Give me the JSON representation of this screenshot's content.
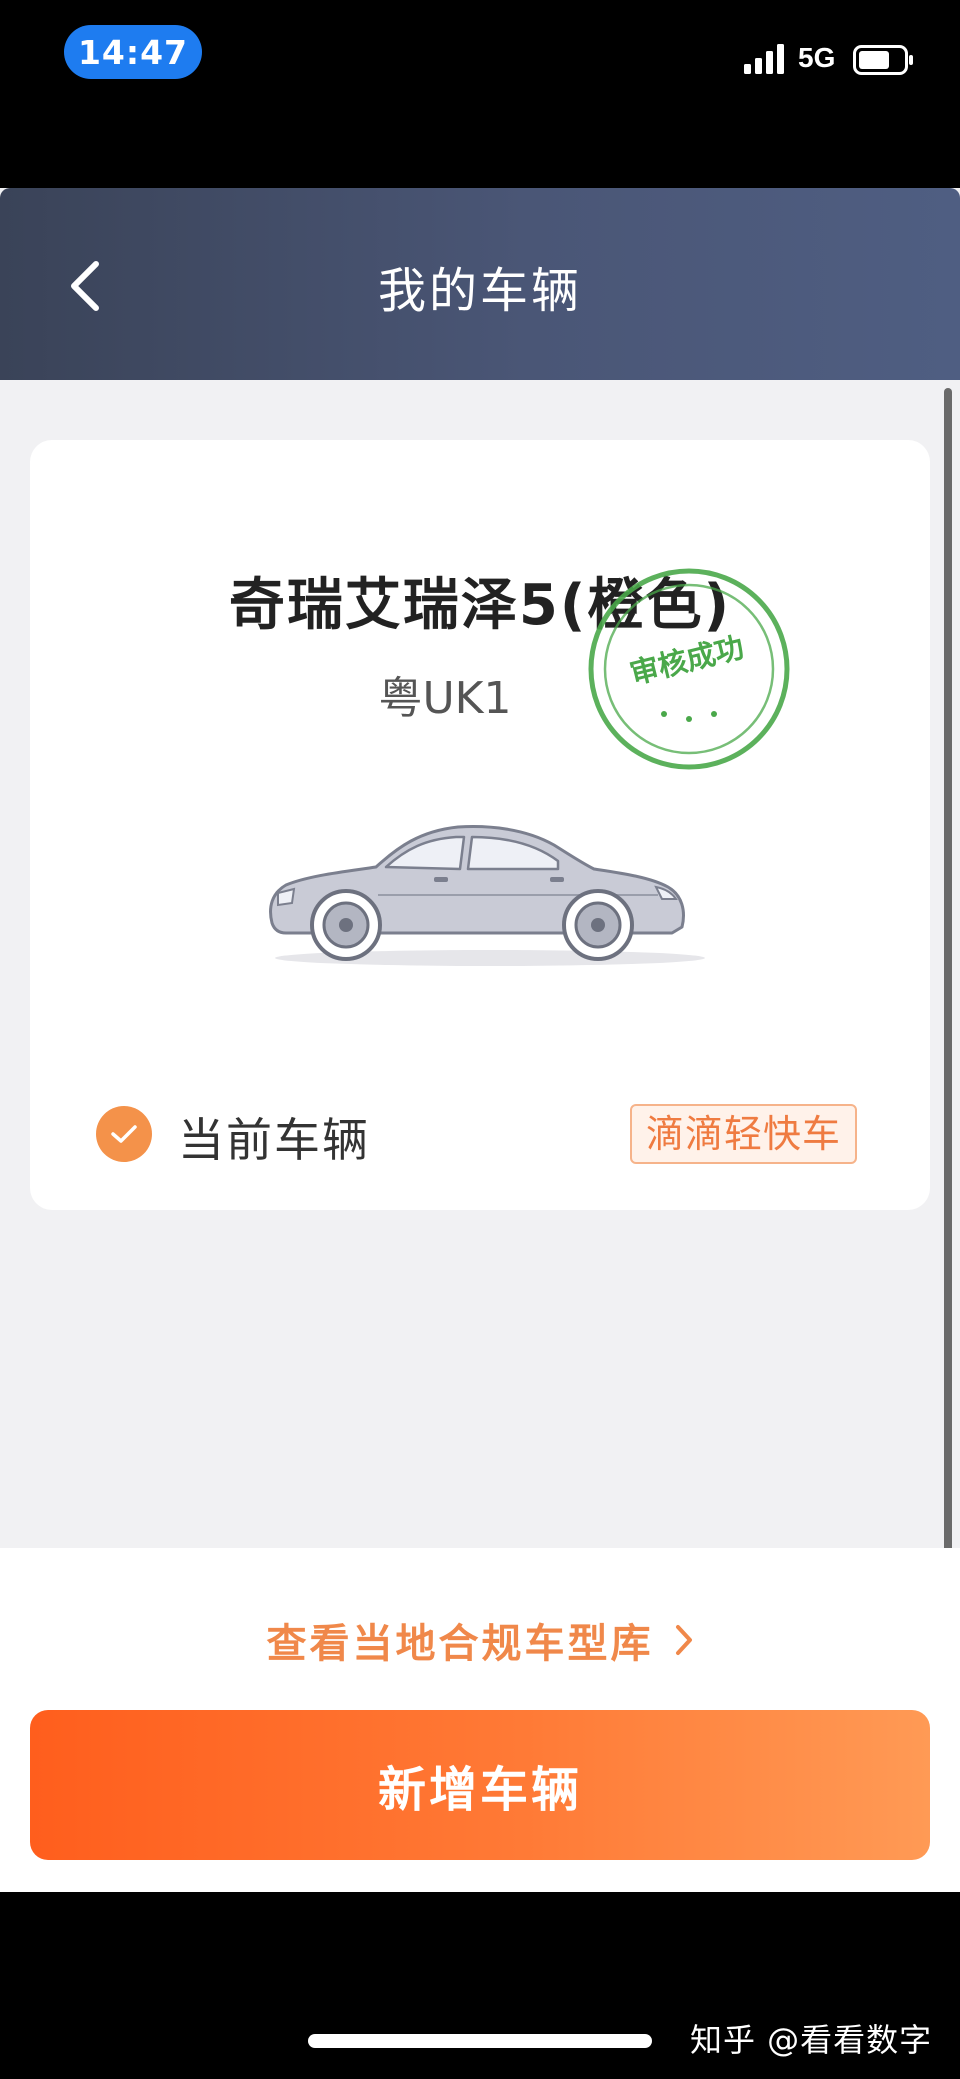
{
  "status_bar": {
    "time": "14:47",
    "network": "5G",
    "icons": [
      "signal-bars-icon",
      "battery-icon"
    ]
  },
  "nav": {
    "title": "我的车辆",
    "back_icon": "chevron-left-icon"
  },
  "vehicle_card": {
    "model": "奇瑞艾瑞泽5(橙色)",
    "plate": "粤UK1",
    "stamp": "审核成功",
    "current_label": "当前车辆",
    "service_tag": "滴滴轻快车"
  },
  "bottom": {
    "compliance_link": "查看当地合规车型库",
    "add_vehicle_button": "新增车辆"
  },
  "watermark": "知乎 @看看数字",
  "colors": {
    "accent_orange": "#ff6a25",
    "check_orange": "#f4924a",
    "stamp_green": "#4aa84a",
    "nav_dark": "#3a4358",
    "time_pill_blue": "#1e7cf0"
  }
}
